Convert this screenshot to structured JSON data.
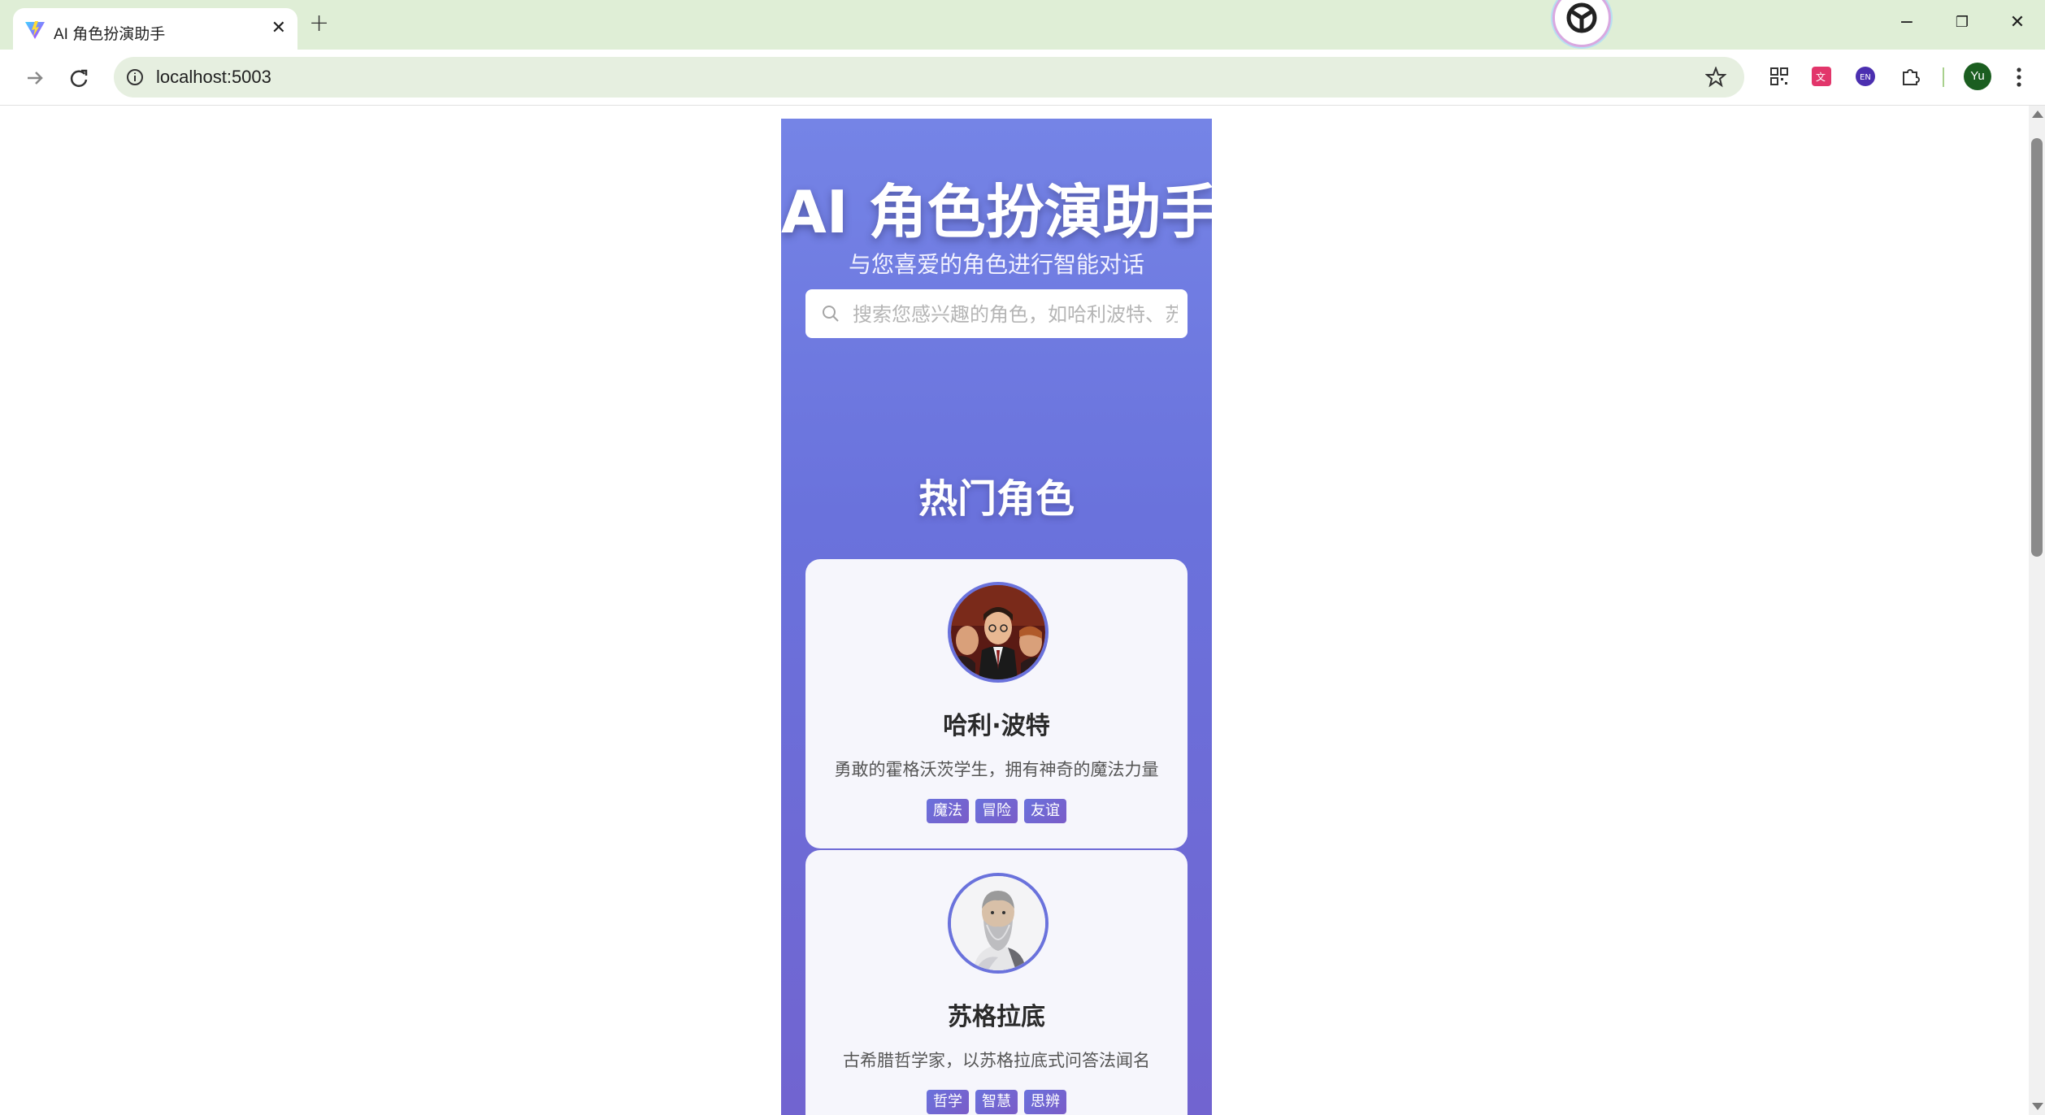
{
  "browser": {
    "tab_title": "AI 角色扮演助手",
    "tab_close": "✕",
    "new_tab": "+",
    "url": "localhost:5003",
    "profile_initials": "Yu",
    "window_controls": [
      "−",
      "❐",
      "✕"
    ]
  },
  "app": {
    "title": "AI 角色扮演助手",
    "subtitle": "与您喜爱的角色进行智能对话",
    "search": {
      "placeholder": "搜索您感兴趣的角色，如哈利波特、苏格拉底...",
      "value": ""
    },
    "section_title": "热门角色",
    "characters": [
      {
        "name": "哈利·波特",
        "description": "勇敢的霍格沃茨学生，拥有神奇的魔法力量",
        "tags": [
          "魔法",
          "冒险",
          "友谊"
        ]
      },
      {
        "name": "苏格拉底",
        "description": "古希腊哲学家，以苏格拉底式问答法闻名",
        "tags": [
          "哲学",
          "智慧",
          "思辨"
        ]
      }
    ]
  },
  "colors": {
    "chrome": "#dfeed6",
    "app_gradient_top": "#7584e6",
    "app_gradient_bottom": "#7164d0",
    "accent": "#6a72dc"
  }
}
